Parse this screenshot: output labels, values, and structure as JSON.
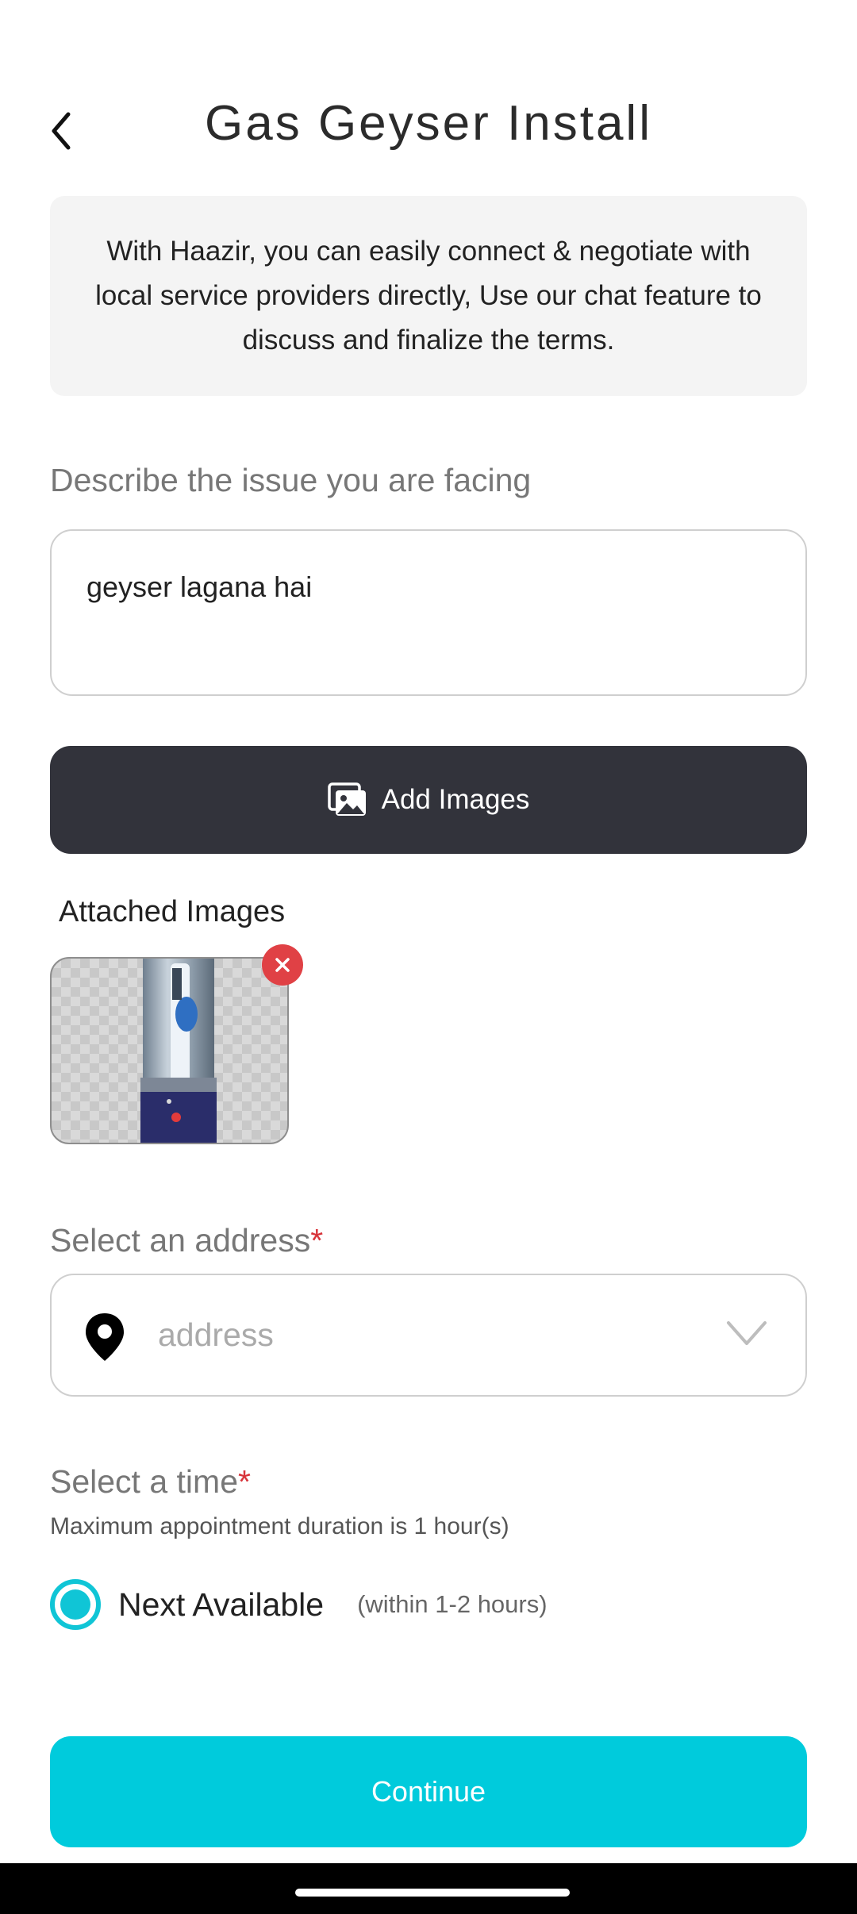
{
  "header": {
    "title": "Gas Geyser Install"
  },
  "info": {
    "text": "With Haazir, you can easily connect & negotiate with local service providers directly,  Use our chat feature to discuss and finalize the terms."
  },
  "describe": {
    "label": "Describe the issue you are facing",
    "value": "geyser lagana hai"
  },
  "add_images": {
    "label": "Add Images",
    "icon": "image-gallery-icon"
  },
  "attached": {
    "label": "Attached Images",
    "count": 1
  },
  "address": {
    "label": "Select an address",
    "required_mark": "*",
    "placeholder": "address",
    "icon": "location-pin-icon"
  },
  "time": {
    "label": "Select a time",
    "required_mark": "*",
    "subtitle": "Maximum appointment duration is 1 hour(s)",
    "option_label": "Next Available",
    "option_hint": "(within 1-2 hours)",
    "selected": true
  },
  "continue": {
    "label": "Continue"
  },
  "colors": {
    "accent": "#00cbdc",
    "dark_button": "#32333b",
    "required": "#d8333a",
    "remove": "#e04145"
  }
}
